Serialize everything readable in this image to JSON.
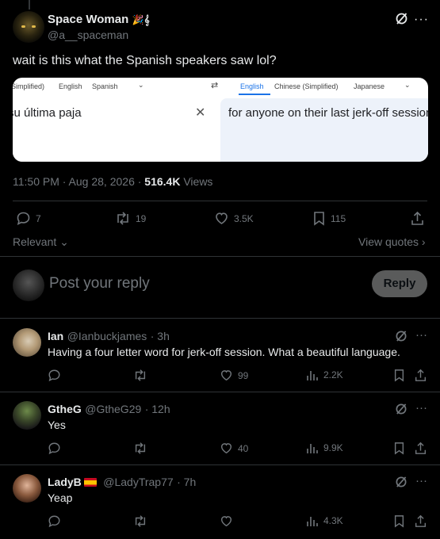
{
  "tweet": {
    "author_name": "Space Woman",
    "author_name_emoji": "🎉𝄞",
    "handle": "@a__spaceman",
    "text": "wait is this what the Spanish speakers saw lol?",
    "timestamp": "11:50 PM · Aug 28, 2026 · ",
    "views_count": "516.4K",
    "views_label": " Views",
    "embed": {
      "source_tabs": [
        "Simplified)",
        "English",
        "Spanish"
      ],
      "target_tabs": [
        "English",
        "Chinese (Simplified)",
        "Japanese"
      ],
      "source_text": "su última paja",
      "target_text": "for anyone on their last jerk-off session",
      "clear_glyph": "✕",
      "swap_glyph": "⇄"
    },
    "stats": {
      "replies": "7",
      "reposts": "19",
      "likes": "3.5K",
      "bookmarks": "115"
    },
    "sort_label": "Relevant",
    "view_quotes": "View quotes"
  },
  "composer": {
    "placeholder": "Post your reply",
    "reply_label": "Reply"
  },
  "replies": [
    {
      "name": "Ian",
      "handle": "@Ianbuckjames",
      "time": "· 3h",
      "text": "Having a four letter word for jerk-off session. What a beautiful language.",
      "reposts": "",
      "likes": "99",
      "views": "2.2K"
    },
    {
      "name": "GtheG",
      "handle": "@GtheG29",
      "time": "· 12h",
      "text": "Yes",
      "reposts": "",
      "likes": "40",
      "views": "9.9K"
    },
    {
      "name": "LadyB",
      "handle": "@LadyTrap77",
      "time": "· 7h",
      "text": "Yeap",
      "reposts": "",
      "likes": "",
      "views": "4.3K"
    }
  ],
  "colors": {
    "background": "#000000",
    "text": "#e7e9ea",
    "muted": "#71767b",
    "divider": "#2f3336",
    "link_blue": "#1a73e8"
  }
}
